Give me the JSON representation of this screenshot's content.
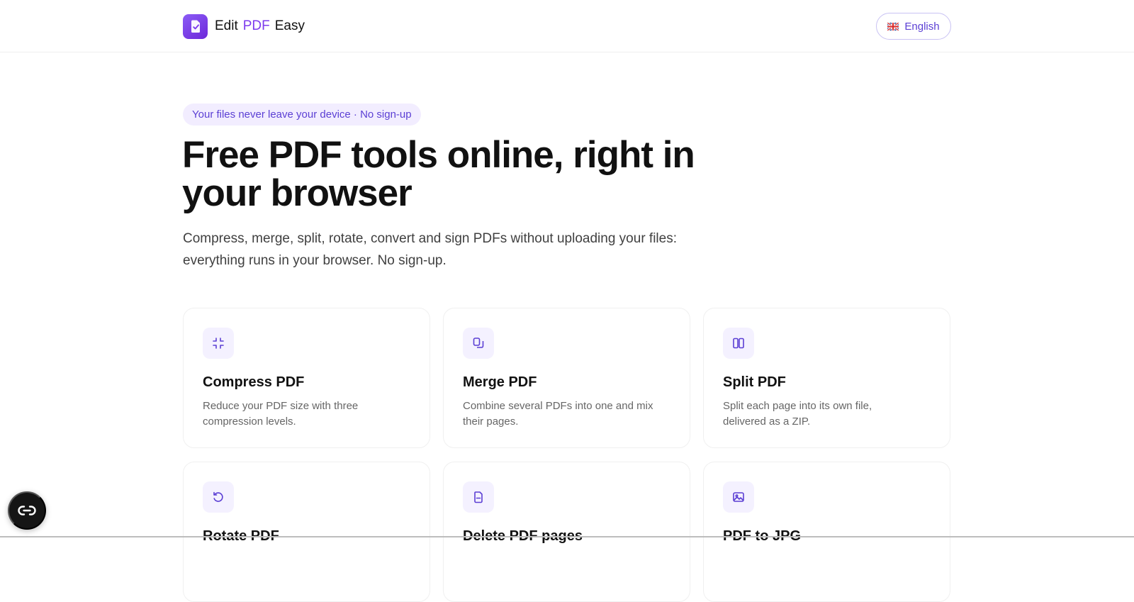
{
  "header": {
    "brand_parts": [
      "Edit",
      "PDF",
      "Easy"
    ],
    "language_label": "English",
    "brand_icon": "document-check-icon",
    "language_icon": "uk-flag-icon"
  },
  "hero": {
    "badge": "Your files never leave your device · No sign-up",
    "title": "Free PDF tools online, right in your browser",
    "subtitle": "Compress, merge, split, rotate, convert and sign PDFs without uploading your files: everything runs in your browser. No sign-up."
  },
  "tools": [
    {
      "title": "Compress PDF",
      "description": "Reduce your PDF size with three compression levels.",
      "icon": "compress-icon"
    },
    {
      "title": "Merge PDF",
      "description": "Combine several PDFs into one and mix their pages.",
      "icon": "merge-icon"
    },
    {
      "title": "Split PDF",
      "description": "Split each page into its own file, delivered as a ZIP.",
      "icon": "split-icon"
    },
    {
      "title": "Rotate PDF",
      "description": "",
      "icon": "rotate-icon"
    },
    {
      "title": "Delete PDF pages",
      "description": "",
      "icon": "delete-page-icon"
    },
    {
      "title": "PDF to JPG",
      "description": "",
      "icon": "image-icon"
    }
  ],
  "floating_action": {
    "icon": "cookie-consent-icon"
  },
  "colors": {
    "accent": "#7c3aed",
    "badge_background": "#f2edff",
    "card_border": "#f0f0f0",
    "floating_background": "#151515"
  }
}
